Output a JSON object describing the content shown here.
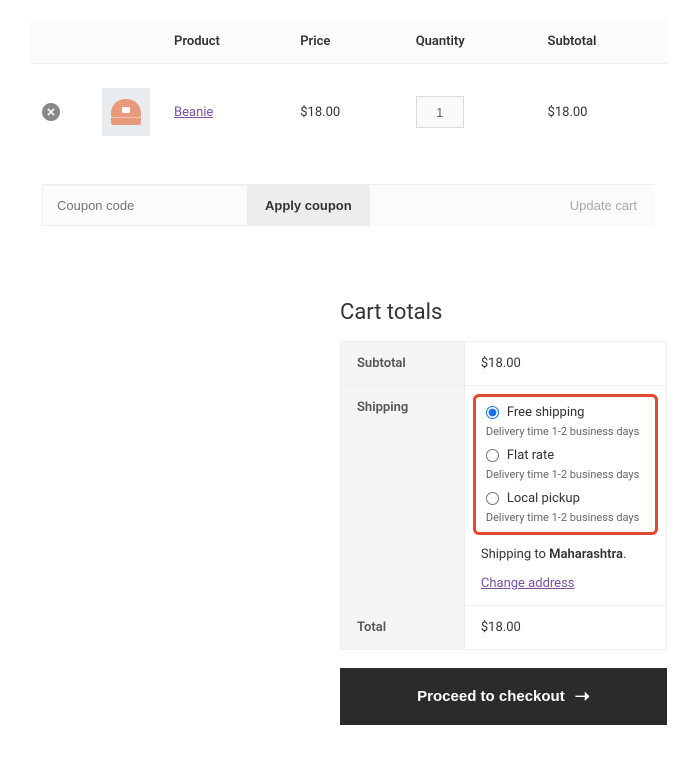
{
  "cart": {
    "headers": {
      "product": "Product",
      "price": "Price",
      "quantity": "Quantity",
      "subtotal": "Subtotal"
    },
    "items": [
      {
        "name": "Beanie",
        "price": "$18.00",
        "quantity": "1",
        "subtotal": "$18.00"
      }
    ],
    "coupon_placeholder": "Coupon code",
    "apply_label": "Apply coupon",
    "update_label": "Update cart"
  },
  "totals": {
    "title": "Cart totals",
    "subtotal_label": "Subtotal",
    "subtotal_value": "$18.00",
    "shipping_label": "Shipping",
    "shipping_options": [
      {
        "label": "Free shipping",
        "note": "Delivery time 1-2 business days",
        "checked": true
      },
      {
        "label": "Flat rate",
        "note": "Delivery time 1-2 business days",
        "checked": false
      },
      {
        "label": "Local pickup",
        "note": "Delivery time 1-2 business days",
        "checked": false
      }
    ],
    "shipping_to_prefix": "Shipping to ",
    "shipping_to_region": "Maharashtra",
    "shipping_to_suffix": ".",
    "change_address_label": "Change address",
    "total_label": "Total",
    "total_value": "$18.00",
    "checkout_label": "Proceed to checkout"
  }
}
